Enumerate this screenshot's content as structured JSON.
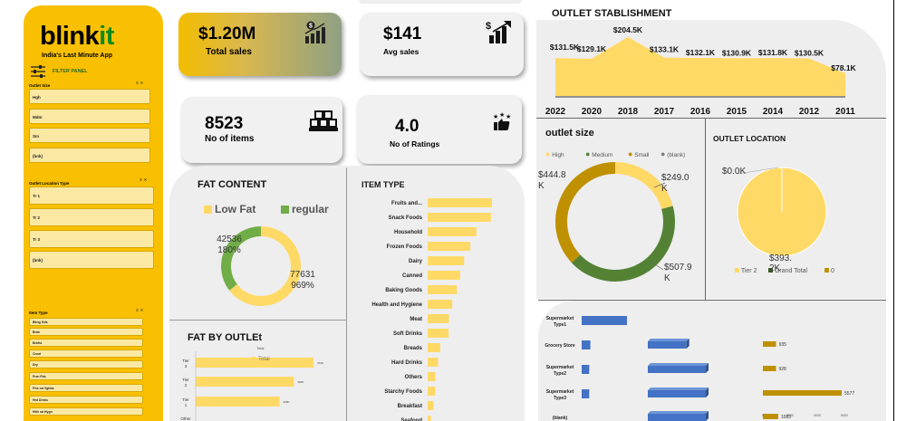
{
  "brand": {
    "logo_main": "blink",
    "logo_accent": "it",
    "tagline": "India's Last Minute App",
    "filter_label": "FILTER PANEL"
  },
  "slicers": [
    {
      "title": "Outlet Size",
      "items": [
        "Hgh",
        "Mdm",
        "Sm",
        "(bnk)"
      ]
    },
    {
      "title": "Outlet Location Type",
      "items": [
        "Tr 1",
        "Tr 2",
        "Tr 3",
        "(bnk)"
      ]
    },
    {
      "title": "Item Type",
      "items": [
        "Bkng Gds",
        "Brds",
        "Brkfst",
        "Cnnd",
        "Dry",
        "Frzn Fds",
        "Frts nd Vgtbls",
        "Hrd Drnks",
        "Hlth nd Hygn"
      ]
    }
  ],
  "kpis": {
    "total_sales_value": "$1.20M",
    "total_sales_label": "Total sales",
    "avg_sales_value": "$141",
    "avg_sales_label": "Avg sales",
    "items_value": "8523",
    "items_label": "No of items",
    "rating_value": "4.0",
    "rating_label": "No of Ratings"
  },
  "colors": {
    "sidebar": "#f8c000",
    "yellow": "#ffd966",
    "green": "#548235",
    "gold": "#bf9000",
    "blue": "#4472c4"
  },
  "icons": [
    "money-bar-chart-icon",
    "dollar-bar-chart-icon",
    "boxes-icon",
    "thumbs-up-stars-icon",
    "filter-sliders-icon"
  ],
  "chart_data": [
    {
      "id": "outlet_establishment",
      "type": "area",
      "title": "OUTLET STABLISHMENT",
      "categories": [
        "2022",
        "2020",
        "2018",
        "2017",
        "2016",
        "2015",
        "2014",
        "2012",
        "2011"
      ],
      "values": [
        131.5,
        129.1,
        204.5,
        133.1,
        132.1,
        130.9,
        131.8,
        130.5,
        78.1
      ],
      "data_labels": [
        "$131.5K",
        "$129.1K",
        "$204.5K",
        "$133.1K",
        "$132.1K",
        "$130.9K",
        "$131.8K",
        "$130.5K",
        "$78.1K"
      ],
      "ylim": [
        0,
        220
      ]
    },
    {
      "id": "fat_content",
      "type": "pie",
      "title": "FAT CONTENT",
      "categories": [
        "Low Fat",
        "regular"
      ],
      "values": [
        77631,
        42536
      ],
      "data_labels": [
        "77631",
        "42536"
      ],
      "percent_labels": [
        "969%",
        "180%"
      ]
    },
    {
      "id": "item_type",
      "type": "bar",
      "title": "ITEM TYPE",
      "categories": [
        "Fruits and...",
        "Snack Foods",
        "Household",
        "Frozen Foods",
        "Dairy",
        "Canned",
        "Baking Goods",
        "Health and Hygiene",
        "Meat",
        "Soft Drinks",
        "Breads",
        "Hard Drinks",
        "Others",
        "Starchy Foods",
        "Breakfast",
        "Seafood"
      ],
      "values": [
        178,
        175,
        135,
        118,
        101,
        90,
        81,
        68,
        59,
        58,
        35,
        29,
        22,
        21,
        16,
        9
      ]
    },
    {
      "id": "outlet_size",
      "type": "pie",
      "title": "outlet size",
      "legend": [
        "High",
        "Medium",
        "Small",
        "(blank)"
      ],
      "categories": [
        "High",
        "Medium",
        "Small"
      ],
      "values": [
        249.0,
        507.9,
        444.8
      ],
      "data_labels": [
        "$249.0 K",
        "$507.9 K",
        "$444.8 K"
      ]
    },
    {
      "id": "outlet_location",
      "type": "pie",
      "title": "OUTLET LOCATION",
      "categories": [
        "Tier 2",
        "Grand Total"
      ],
      "values": [
        393,
        0
      ],
      "data_labels": [
        "$393. 2K",
        "$0.0K"
      ],
      "legend": [
        "Tier 2",
        "Grand Total",
        "0"
      ]
    },
    {
      "id": "fat_by_outlet",
      "type": "bar",
      "title": "FAT BY OUTLEt",
      "legend": [
        "Total"
      ],
      "series_label": "Total",
      "categories": [
        "Tier 3",
        "Tier 2",
        "Tier 1",
        "Other"
      ],
      "values": [
        472,
        393,
        336,
        0
      ]
    },
    {
      "id": "outlet_type",
      "type": "bar",
      "categories": [
        "Supermarket Type1",
        "Grocery Store",
        "Supermarket Type2",
        "Supermarket Type3",
        "(blank)"
      ],
      "series": [
        {
          "values": [
            787,
            151,
            131,
            131,
            0
          ]
        },
        {
          "values": [
            0,
            935,
            1400,
            1400,
            1400
          ]
        },
        {
          "values": [
            0,
            935,
            928,
            5577,
            1083
          ]
        }
      ],
      "data_labels": [
        "935",
        "928",
        "5577",
        "1083"
      ],
      "axis_ticks": [
        "0",
        "2000",
        "4000",
        "6000"
      ]
    }
  ]
}
